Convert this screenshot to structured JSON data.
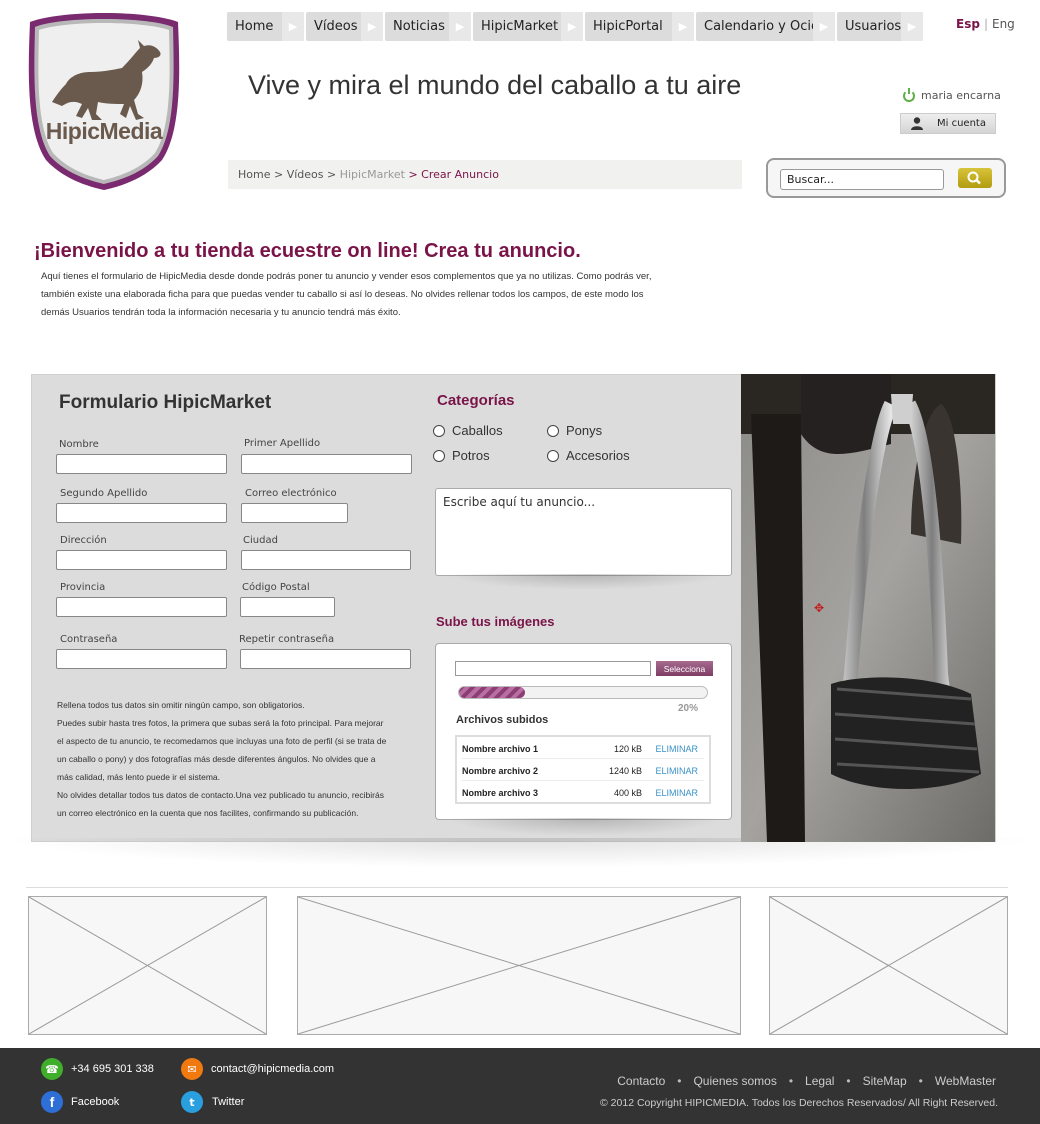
{
  "logo": {
    "text": "HipicMedia"
  },
  "nav": {
    "items": [
      {
        "label": "Home"
      },
      {
        "label": "Vídeos"
      },
      {
        "label": "Noticias"
      },
      {
        "label": "HipicMarket"
      },
      {
        "label": "HipicPortal"
      },
      {
        "label": "Calendario y Ocio"
      },
      {
        "label": "Usuarios"
      }
    ]
  },
  "lang": {
    "esp": "Esp",
    "eng": "Eng"
  },
  "tagline": "Vive y mira el mundo del caballo a tu aire",
  "user": {
    "name": "maria encarna",
    "account_label": "Mi cuenta"
  },
  "breadcrumb": {
    "home": "Home",
    "sep1": " > ",
    "videos": "Vídeos",
    "sep2": " > ",
    "market": "HipicMarket",
    "sep3": " > ",
    "current": "Crear Anuncio"
  },
  "search": {
    "value": "Buscar..."
  },
  "welcome": {
    "title": "¡Bienvenido a tu tienda ecuestre on line! Crea tu anuncio.",
    "line1": "Aquí tienes el formulario de HipicMedia desde donde podrás poner tu anuncio y vender esos complementos que ya no utilizas. Como podrás ver,",
    "line2": "también existe una elaborada ficha para que puedas vender tu caballo si así lo deseas. No olvides rellenar todos los campos, de este modo los",
    "line3": "demás Usuarios tendrán toda la información necesaria y tu anuncio tendrá más éxito."
  },
  "form": {
    "title": "Formulario HipicMarket",
    "nombre": "Nombre",
    "apellido1": "Primer Apellido",
    "apellido2": "Segundo Apellido",
    "email": "Correo electrónico",
    "direccion": "Dirección",
    "ciudad": "Ciudad",
    "provincia": "Provincia",
    "cp": "Código Postal",
    "pass": "Contraseña",
    "pass2": "Repetir contraseña",
    "note1": "Rellena todos tus datos sin omitir ningún campo, son obligatorios.",
    "note2": "Puedes subir hasta tres fotos, la primera que subas será la foto principal. Para mejorar",
    "note3": "el aspecto de tu anuncio, te recomedamos que incluyas una foto de perfil (si se trata de",
    "note4": "un caballo o pony) y dos fotografías más desde diferentes ángulos. No olvides que a",
    "note5": "más calidad, más lento puede ir el sistema.",
    "note6": "No olvides detallar todos tus datos de contacto.Una vez publicado tu anuncio, recibirás",
    "note7": "un correo electrónico en la cuenta que nos facilites, confirmando su publicación."
  },
  "categories": {
    "title": "Categorías",
    "caballos": "Caballos",
    "ponys": "Ponys",
    "potros": "Potros",
    "accesorios": "Accesorios"
  },
  "ad": {
    "value": "Escribe aquí tu anuncio..."
  },
  "upload": {
    "title": "Sube tus imágenes",
    "select_label": "Selecciona",
    "progress": 0.2,
    "progress_label": "20%",
    "files_title": "Archivos subidos",
    "files": [
      {
        "name": "Nombre archivo 1",
        "size": "120 kB",
        "action": "ELIMINAR"
      },
      {
        "name": "Nombre archivo 2",
        "size": "1240 kB",
        "action": "ELIMINAR"
      },
      {
        "name": "Nombre archivo 3",
        "size": "400 kB",
        "action": "ELIMINAR"
      }
    ]
  },
  "footer": {
    "phone": "+34 695 301 338",
    "email": "contact@hipicmedia.com",
    "facebook": "Facebook",
    "twitter": "Twitter",
    "links": {
      "contacto": "Contacto",
      "quienes": "Quienes somos",
      "legal": "Legal",
      "sitemap": "SiteMap",
      "webmaster": "WebMaster"
    },
    "copyright": "© 2012 Copyright HIPICMEDIA. Todos los Derechos Reservados/ All Right Reserved."
  },
  "colors": {
    "brand": "#7a1448",
    "accent": "#5fb045",
    "search_button": "#c9b21e",
    "link": "#3a92c8"
  }
}
